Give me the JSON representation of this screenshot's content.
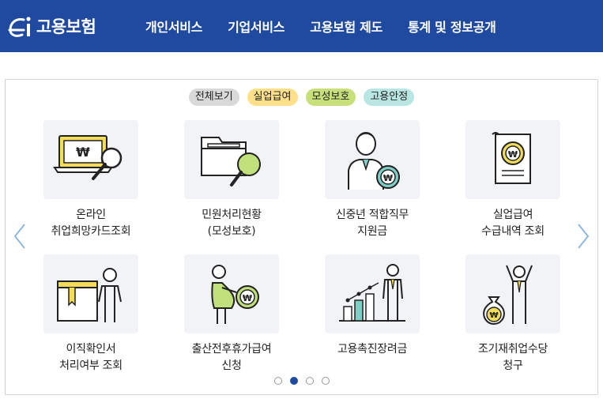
{
  "header": {
    "logo_text": "고용보험",
    "nav": [
      "개인서비스",
      "기업서비스",
      "고용보험 제도",
      "통계 및 정보공개"
    ]
  },
  "filters": [
    {
      "label": "전체보기",
      "color": "#d9d9d9"
    },
    {
      "label": "실업급여",
      "color": "#ffe08a"
    },
    {
      "label": "모성보호",
      "color": "#c8e07a"
    },
    {
      "label": "고용안정",
      "color": "#b9e6e2"
    }
  ],
  "cards": [
    {
      "label": "온라인\n취업희망카드조회",
      "icon": "monitor-magnifier-icon"
    },
    {
      "label": "민원처리현황\n(모성보호)",
      "icon": "folder-search-icon"
    },
    {
      "label": "신중년 적합직무\n지원금",
      "icon": "senior-worker-coin-icon"
    },
    {
      "label": "실업급여\n수급내역 조회",
      "icon": "receipt-coin-icon"
    },
    {
      "label": "이직확인서\n처리여부 조회",
      "icon": "book-person-icon"
    },
    {
      "label": "출산전후휴가급여\n신청",
      "icon": "pregnant-woman-coin-icon"
    },
    {
      "label": "고용촉진장려금",
      "icon": "growth-chart-person-icon"
    },
    {
      "label": "조기재취업수당\n청구",
      "icon": "cheering-person-moneybag-icon"
    }
  ],
  "pagination": {
    "count": 4,
    "active_index": 1
  },
  "colors": {
    "brand_blue": "#1f4aa0",
    "accent_yellow": "#f3dc5a",
    "accent_green": "#bfe07a",
    "accent_teal": "#7fcfc6"
  }
}
